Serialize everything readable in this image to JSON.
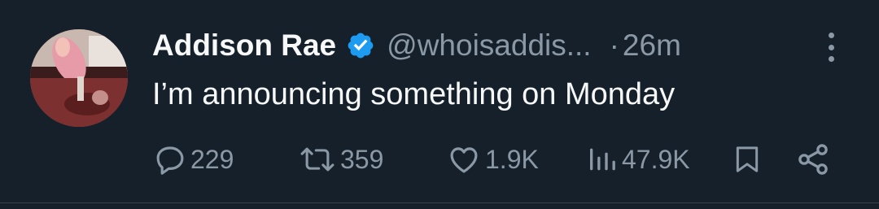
{
  "author": {
    "display_name": "Addison Rae",
    "handle": "@whoisaddis...",
    "timestamp": "26m",
    "separator": "·"
  },
  "tweet": {
    "text": "I’m announcing something on Monday"
  },
  "metrics": {
    "replies": "229",
    "retweets": "359",
    "likes": "1.9K",
    "views": "47.9K"
  },
  "colors": {
    "background": "#15202b",
    "verified": "#1d9bf0",
    "muted": "#8b98a5",
    "text": "#f7f9f9"
  },
  "icons": [
    "verified-badge-icon",
    "more-icon",
    "reply-icon",
    "retweet-icon",
    "like-icon",
    "views-icon",
    "bookmark-icon",
    "share-icon"
  ]
}
